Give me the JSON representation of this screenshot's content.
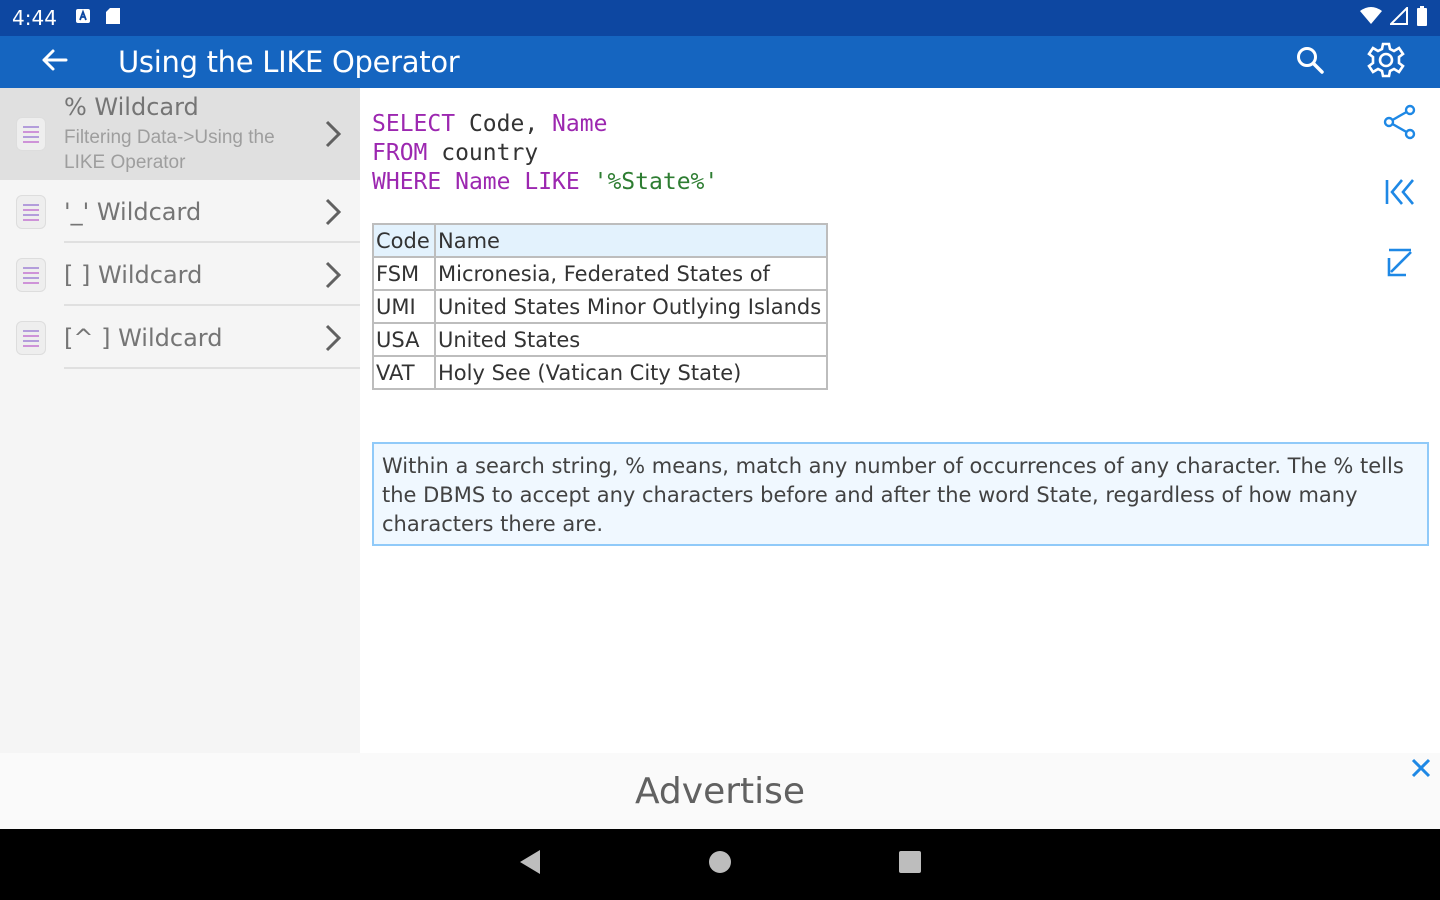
{
  "status": {
    "time": "4:44"
  },
  "app_bar": {
    "title": "Using the LIKE Operator"
  },
  "sidebar": {
    "items": [
      {
        "title": "% Wildcard",
        "subtitle": "Filtering Data->Using the LIKE Operator"
      },
      {
        "title": "'_' Wildcard"
      },
      {
        "title": "[ ] Wildcard"
      },
      {
        "title": "[^ ] Wildcard"
      }
    ]
  },
  "sql": {
    "line1_kw1": "SELECT",
    "line1_rest": " Code, ",
    "line1_kw2": "Name",
    "line2_kw": "FROM",
    "line2_rest": " country",
    "line3_kw1": "WHERE",
    "line3_sp1": " ",
    "line3_kw2": "Name",
    "line3_sp2": " ",
    "line3_kw3": "LIKE",
    "line3_sp3": " ",
    "line3_str": "'%State%'"
  },
  "table": {
    "headers": [
      "Code",
      "Name"
    ],
    "rows": [
      [
        "FSM",
        "Micronesia, Federated States of"
      ],
      [
        "UMI",
        "United States Minor Outlying Islands"
      ],
      [
        "USA",
        "United States"
      ],
      [
        "VAT",
        "Holy See (Vatican City State)"
      ]
    ]
  },
  "note": {
    "text": "Within a search string, % means, match any number of occurrences of any character. The % tells the DBMS to accept any characters before and after the word State, regardless of how many characters there are."
  },
  "ad": {
    "label": "Advertise"
  },
  "colors": {
    "status_bar": "#0d47a1",
    "app_bar": "#1565c0",
    "accent": "#1e88e5",
    "keyword": "#9c27b0",
    "string": "#2e7d32"
  },
  "icons": {
    "app_bar": [
      "arrow-left-icon",
      "search-icon",
      "gear-icon"
    ],
    "side_actions": [
      "share-icon",
      "first-page-icon",
      "last-page-icon"
    ],
    "nav": [
      "back-triangle-icon",
      "home-circle-icon",
      "recents-square-icon"
    ]
  }
}
